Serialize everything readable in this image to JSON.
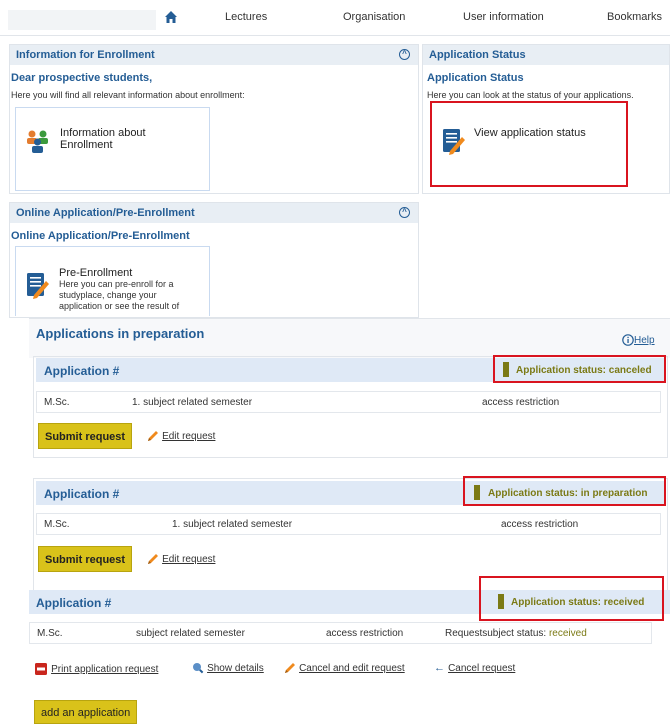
{
  "nav": {
    "items": [
      "Lectures",
      "Organisation",
      "User information",
      "Bookmarks"
    ]
  },
  "enroll_panel": {
    "header": "Information for Enrollment",
    "greeting": "Dear prospective students,",
    "intro": "Here you will find all relevant information about enrollment:",
    "tile_title": "Information about Enrollment"
  },
  "status_panel": {
    "header": "Application Status",
    "title": "Application Status",
    "intro": "Here you can look at the status of your applications.",
    "tile_title": "View application status"
  },
  "online_panel": {
    "header": "Online Application/Pre-Enrollment",
    "title": "Online Application/Pre-Enrollment",
    "tile_title": "Pre-Enrollment",
    "tile_desc_1": "Here you can pre-enroll for a",
    "tile_desc_2": "studyplace, change your",
    "tile_desc_3": "application or see the result of"
  },
  "apps": {
    "title": "Applications in preparation",
    "help": "Help",
    "add_button": "add an application",
    "items": [
      {
        "title": "Application #",
        "status": "Application status: canceled",
        "degree": "M.Sc.",
        "subject": "1. subject related semester",
        "restriction": "access restriction",
        "submit": "Submit request",
        "edit": "Edit request"
      },
      {
        "title": "Application #",
        "status": "Application status: in preparation",
        "degree": "M.Sc.",
        "subject": "1. subject related semester",
        "restriction": "access restriction",
        "submit": "Submit request",
        "edit": "Edit request"
      },
      {
        "title": "Application #",
        "status": "Application status: received",
        "degree": "M.Sc.",
        "subject": "subject related semester",
        "restriction": "access restriction",
        "request_status_label": "Requestsubject status:",
        "request_status_value": "received",
        "print": "Print application request",
        "details": "Show details",
        "cancel_edit": "Cancel and edit request",
        "cancel": "Cancel request"
      }
    ]
  },
  "colors": {
    "accent": "#245d95",
    "status_olive": "#7b7a15",
    "button_yellow": "#d9c21a",
    "highlight_red": "#d9141f"
  }
}
